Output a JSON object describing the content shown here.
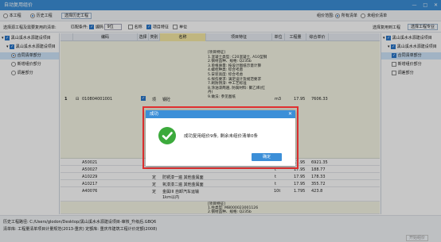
{
  "window": {
    "title": "自动复用组价",
    "controls": [
      "—",
      "□",
      "✕"
    ]
  },
  "toolbar1": {
    "radio_this_project": "本工程",
    "radio_history": "历史工程",
    "select_history_button": "选择历史工程",
    "scope_label": "组价范围:",
    "scope_all": "所有清单",
    "scope_unpriced": "未组价清单"
  },
  "toolbar2": {
    "left_label": "选择源工程及需要复用的清单:",
    "match_label": "匹配条件:",
    "match_code": "编码",
    "match_code_digits": "9位",
    "match_name": "名称",
    "match_feature": "项目特征",
    "match_unit": "单位",
    "right_label": "选择复用到工程",
    "select_project_button": "选择工程专业"
  },
  "left_tree": [
    {
      "label": "黑山溪水水源建设项目",
      "level": 0,
      "checked": true
    },
    {
      "label": "黑山溪水水源建设项目",
      "level": 1,
      "checked": true
    },
    {
      "label": "合同清单部分",
      "level": 2,
      "selected": true
    },
    {
      "label": "新增组价部分",
      "level": 2
    },
    {
      "label": "调差部分",
      "level": 2
    }
  ],
  "right_tree": [
    {
      "label": "黑山溪水水源建设项目",
      "level": 0,
      "checked": true
    },
    {
      "label": "黑山溪水水源建设项目",
      "level": 1,
      "checked": true
    },
    {
      "label": "合同清单部分",
      "level": 2,
      "checked": true,
      "selected": true
    },
    {
      "label": "新增组价部分",
      "level": 2,
      "checked": false
    },
    {
      "label": "调差部分",
      "level": 2,
      "checked": false
    }
  ],
  "grid": {
    "headers": [
      "编码",
      "选择",
      "类别",
      "名称",
      "项目特征",
      "单位",
      "工程量",
      "综合单价"
    ],
    "main_row": {
      "index": "1",
      "code": "010804001001",
      "category": "项",
      "name": "钢砼",
      "unit": "m3",
      "qty": "17.95",
      "price": "7606.33",
      "features": [
        "[项目特征]",
        "1.混凝土类型: C20混凝土, A10型钢",
        "2.钢材品种、规格: Q235b",
        "3.单根质量: 按设计图纸示意计算",
        "4.螺栓种类: 综合考虑",
        "5.安装高度: 综合考虑",
        "6.探伤要求: 满足设计及规范要求",
        "7.刷防锈漆: 中工艺标准",
        "8.涂油漆两遍, 防腐材料: 聚乙烯(红丹)",
        "9.做法: 参见图纸"
      ]
    },
    "rows": [
      {
        "code": "A50021",
        "cat": "",
        "name": "",
        "unit": "t",
        "qty": "17.95",
        "price": "6921.35"
      },
      {
        "code": "A50027",
        "cat": "",
        "name": "",
        "unit": "t",
        "qty": "17.95",
        "price": "188.77"
      },
      {
        "code": "A10229",
        "cat": "定",
        "name": "防锈漆一遍 其他金属面",
        "unit": "t",
        "qty": "17.95",
        "price": "178.33"
      },
      {
        "code": "A10217",
        "cat": "定",
        "name": "氧漆漆二遍 其他金属面",
        "unit": "t",
        "qty": "17.95",
        "price": "355.72"
      },
      {
        "code": "A40076",
        "cat": "定",
        "name": "金属III 自卸汽车运输 1km以内",
        "unit": "10t",
        "qty": "1.795",
        "price": "423.8"
      }
    ],
    "tail_features": [
      "[项目特征]",
      "1.柱类型: M8000023001126",
      "2.钢材品种、规格: Q235b"
    ]
  },
  "status": {
    "project_path": "历史工程路径: C:/Users/glodon/Desktop/黑山溪水水源建设项目-审核_升级后.GBQ6",
    "norms": "清单库: 工程量清单项目计量规范(2013-重庆)   定额库: 重庆市建筑工程计价定额(2008)",
    "apply_button": "开始组价"
  },
  "dialog": {
    "title": "成功",
    "message": "成功复用组价9条, 剩余未组价清单0条",
    "ok": "确定",
    "icon": "check-circle-icon",
    "accent": "#3c8fd8",
    "success_color": "#3caa3c",
    "highlight_color": "#e03030"
  }
}
